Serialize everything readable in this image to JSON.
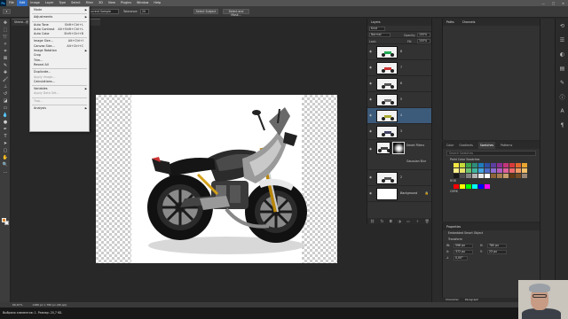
{
  "app": {
    "logo": "Ps"
  },
  "menubar": {
    "items": [
      "File",
      "Edit",
      "Image",
      "Layer",
      "Type",
      "Select",
      "Filter",
      "3D",
      "View",
      "Plugins",
      "Window",
      "Help"
    ],
    "active": "Edit",
    "window_controls": [
      "—",
      "□",
      "✕"
    ]
  },
  "options_bar": {
    "sample_value": "Current Sample",
    "tolerance_label": "Tolerance:",
    "tolerance_value": "20",
    "select_subject": "Select Subject",
    "select_and_mask": "Select and Mask..."
  },
  "document_tab": {
    "title": "Shield...@ 66,7% (Smart...)"
  },
  "edit_menu": [
    {
      "label": "Mode",
      "submenu": true
    },
    {
      "sep": true
    },
    {
      "label": "Adjustments",
      "submenu": true
    },
    {
      "sep": true
    },
    {
      "label": "Auto Tone",
      "shortcut": "Shift+Ctrl+L"
    },
    {
      "label": "Auto Contrast",
      "shortcut": "Alt+Shift+Ctrl+L"
    },
    {
      "label": "Auto Color",
      "shortcut": "Shift+Ctrl+B"
    },
    {
      "sep": true
    },
    {
      "label": "Image Size...",
      "shortcut": "Alt+Ctrl+I"
    },
    {
      "label": "Canvas Size...",
      "shortcut": "Alt+Ctrl+C"
    },
    {
      "label": "Image Rotation",
      "submenu": true
    },
    {
      "label": "Crop"
    },
    {
      "label": "Trim..."
    },
    {
      "label": "Reveal All"
    },
    {
      "sep": true
    },
    {
      "label": "Duplicate..."
    },
    {
      "label": "Apply Image...",
      "disabled": true
    },
    {
      "label": "Calculations..."
    },
    {
      "sep": true
    },
    {
      "label": "Variables",
      "submenu": true
    },
    {
      "label": "Apply Data Set...",
      "disabled": true
    },
    {
      "sep": true
    },
    {
      "label": "Trap...",
      "disabled": true
    },
    {
      "sep": true
    },
    {
      "label": "Analysis",
      "submenu": true
    }
  ],
  "layers_panel": {
    "title": "Layers",
    "kind_label": "Kind",
    "blend_mode": "Normal",
    "opacity_label": "Opacity:",
    "opacity": "100%",
    "lock_label": "Lock:",
    "fill_label": "Fill:",
    "fill": "100%",
    "layers": [
      {
        "name": "8",
        "selected": false
      },
      {
        "name": "7",
        "selected": false
      },
      {
        "name": "6",
        "selected": false
      },
      {
        "name": "5",
        "selected": false
      },
      {
        "name": "4",
        "selected": true
      },
      {
        "name": "3",
        "selected": false
      }
    ],
    "smart_layer": {
      "smart_filters": "Smart Filters",
      "gaussian_blur": "Gaussian Blur"
    },
    "last_layer": {
      "name": "2"
    },
    "background": {
      "name": "Background"
    },
    "footer_icons": [
      "link-icon",
      "fx-icon",
      "mask-icon",
      "adjust-icon",
      "folder-icon",
      "new-layer-icon",
      "trash-icon"
    ]
  },
  "paths_panel": {
    "tabs": [
      "Paths",
      "Channels"
    ]
  },
  "swatches_panel": {
    "tabs": [
      "Color",
      "Gradients",
      "Swatches",
      "Patterns"
    ],
    "active_tab": "Swatches",
    "search_placeholder": "Search Swatches",
    "groups": [
      "Paint Color Swatches",
      "RGB",
      "CMYK"
    ],
    "colors_row1": [
      "#f5e642",
      "#c7d93a",
      "#3aa34b",
      "#2e8c7a",
      "#1f7bbd",
      "#2e4fa3",
      "#5b3fa0",
      "#8d2f96",
      "#c23579",
      "#d73a3a",
      "#e2682e",
      "#e8a52f"
    ],
    "colors_row2": [
      "#fff08a",
      "#e8e36a",
      "#6cc070",
      "#3fb6a0",
      "#44a5e0",
      "#4c6cc9",
      "#8b6fd0",
      "#b45cc0",
      "#e0619e",
      "#ee6b6b",
      "#f29a62",
      "#f4c16b"
    ],
    "colors_row3": [
      "#1a1a1a",
      "#4d4d4d",
      "#808080",
      "#b3b3b3",
      "#e6e6e6",
      "#ffffff",
      "#8c6239",
      "#a67c52",
      "#c69c6d",
      "#603813",
      "#754c24",
      "#998675"
    ],
    "rgb_colors": [
      "#ff0000",
      "#ffff00",
      "#00ff00",
      "#00ffff",
      "#0000ff",
      "#ff00ff"
    ]
  },
  "properties_panel": {
    "title": "Properties",
    "type": "Embedded Smart Object",
    "transform_label": "Transform",
    "w": "596 px",
    "h": "780 px",
    "x": "372 px",
    "y": "23 px",
    "angle": "0,00°"
  },
  "character_panel": {
    "tabs": [
      "Character",
      "Paragraph"
    ]
  },
  "status": {
    "zoom": "66,67%",
    "size": "1486 px x 780 px (96 ppi)",
    "hint": "Выбрано элементов: 1. Размер: 20,7 КБ."
  }
}
